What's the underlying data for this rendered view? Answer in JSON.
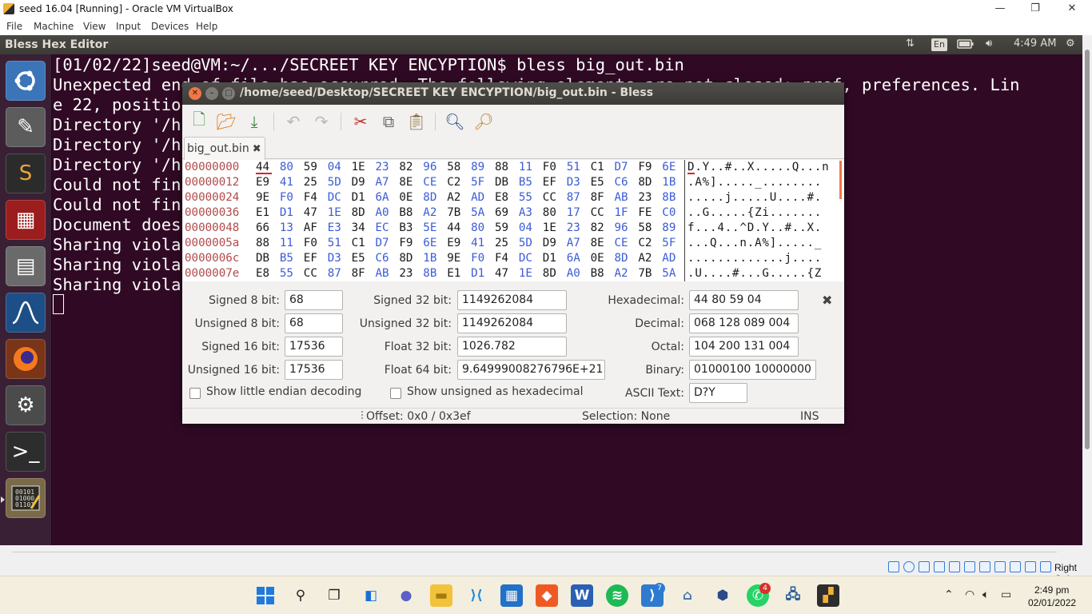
{
  "host_window": {
    "title": "seed 16.04 [Running] - Oracle VM VirtualBox",
    "menu": [
      "File",
      "Machine",
      "View",
      "Input",
      "Devices",
      "Help"
    ],
    "controls": {
      "minimize": "—",
      "restore": "❐",
      "close": "✕"
    }
  },
  "ubuntu_topbar": {
    "active_app": "Bless Hex Editor",
    "keyboard_layout": "En",
    "time": "4:49 AM",
    "icons": [
      "network-arrows-icon",
      "battery-icon",
      "volume-icon",
      "power-gear-icon"
    ]
  },
  "launcher": {
    "items": [
      "ubuntu-dash",
      "text-editor",
      "sublime-text",
      "remote-desktop",
      "file-manager",
      "wireshark",
      "firefox",
      "system-settings",
      "terminal",
      "bless-hex-editor"
    ]
  },
  "terminal": {
    "lines": [
      "[01/02/22]seed@VM:~/.../SECREET KEY ENCYPTION$ bless big_out.bin",
      "Unexpected end of file has occurred. The following elements are not closed: pref, preferences. Lin",
      "e 22, position",
      "Directory '/h",
      "Directory '/h",
      "Directory '/h",
      "Could not fin",
      "Could not fin",
      "Document does",
      "Sharing viola",
      "Sharing viola",
      "Sharing viola"
    ]
  },
  "bless": {
    "title": "/home/seed/Desktop/SECREET KEY ENCYPTION/big_out.bin - Bless",
    "tab_label": "big_out.bin",
    "hex_rows": [
      {
        "offset": "00000000",
        "bytes": [
          "44",
          "80",
          "59",
          "04",
          "1E",
          "23",
          "82",
          "96",
          "58",
          "89",
          "88",
          "11",
          "F0",
          "51",
          "C1",
          "D7",
          "F9",
          "6E"
        ],
        "ascii": "D.Y..#..X.....Q...n"
      },
      {
        "offset": "00000012",
        "bytes": [
          "E9",
          "41",
          "25",
          "5D",
          "D9",
          "A7",
          "8E",
          "CE",
          "C2",
          "5F",
          "DB",
          "B5",
          "EF",
          "D3",
          "E5",
          "C6",
          "8D",
          "1B"
        ],
        "ascii": ".A%]....._........"
      },
      {
        "offset": "00000024",
        "bytes": [
          "9E",
          "F0",
          "F4",
          "DC",
          "D1",
          "6A",
          "0E",
          "8D",
          "A2",
          "AD",
          "E8",
          "55",
          "CC",
          "87",
          "8F",
          "AB",
          "23",
          "8B"
        ],
        "ascii": ".....j.....U....#."
      },
      {
        "offset": "00000036",
        "bytes": [
          "E1",
          "D1",
          "47",
          "1E",
          "8D",
          "A0",
          "B8",
          "A2",
          "7B",
          "5A",
          "69",
          "A3",
          "80",
          "17",
          "CC",
          "1F",
          "FE",
          "C0"
        ],
        "ascii": "..G.....{Zi......."
      },
      {
        "offset": "00000048",
        "bytes": [
          "66",
          "13",
          "AF",
          "E3",
          "34",
          "EC",
          "B3",
          "5E",
          "44",
          "80",
          "59",
          "04",
          "1E",
          "23",
          "82",
          "96",
          "58",
          "89"
        ],
        "ascii": "f...4..^D.Y..#..X."
      },
      {
        "offset": "0000005a",
        "bytes": [
          "88",
          "11",
          "F0",
          "51",
          "C1",
          "D7",
          "F9",
          "6E",
          "E9",
          "41",
          "25",
          "5D",
          "D9",
          "A7",
          "8E",
          "CE",
          "C2",
          "5F"
        ],
        "ascii": "...Q...n.A%]....._"
      },
      {
        "offset": "0000006c",
        "bytes": [
          "DB",
          "B5",
          "EF",
          "D3",
          "E5",
          "C6",
          "8D",
          "1B",
          "9E",
          "F0",
          "F4",
          "DC",
          "D1",
          "6A",
          "0E",
          "8D",
          "A2",
          "AD"
        ],
        "ascii": ".............j...."
      },
      {
        "offset": "0000007e",
        "bytes": [
          "E8",
          "55",
          "CC",
          "87",
          "8F",
          "AB",
          "23",
          "8B",
          "E1",
          "D1",
          "47",
          "1E",
          "8D",
          "A0",
          "B8",
          "A2",
          "7B",
          "5A"
        ],
        "ascii": ".U....#...G.....{Z"
      }
    ],
    "conversion": {
      "signed_8_label": "Signed 8 bit:",
      "signed_8": "68",
      "unsigned_8_label": "Unsigned 8 bit:",
      "unsigned_8": "68",
      "signed_16_label": "Signed 16 bit:",
      "signed_16": "17536",
      "unsigned_16_label": "Unsigned 16 bit:",
      "unsigned_16": "17536",
      "signed_32_label": "Signed 32 bit:",
      "signed_32": "1149262084",
      "unsigned_32_label": "Unsigned 32 bit:",
      "unsigned_32": "1149262084",
      "float_32_label": "Float 32 bit:",
      "float_32": "1026.782",
      "float_64_label": "Float 64 bit:",
      "float_64": "9.64999008276796E+21",
      "hex_label": "Hexadecimal:",
      "hex": "44 80 59 04",
      "decimal_label": "Decimal:",
      "decimal": "068 128 089 004",
      "octal_label": "Octal:",
      "octal": "104 200 131 004",
      "binary_label": "Binary:",
      "binary": "01000100 10000000 01011001 00000100",
      "ascii_label": "ASCII Text:",
      "ascii": "D?Y",
      "little_endian_label": "Show little endian decoding",
      "unsigned_hex_label": "Show unsigned as hexadecimal"
    },
    "status": {
      "offset": "Offset: 0x0 / 0x3ef",
      "selection": "Selection: None",
      "mode": "INS"
    }
  },
  "vbox_status": {
    "host_key": "Right Ctrl"
  },
  "taskbar": {
    "time": "2:49 pm",
    "date": "02/01/2022",
    "badges": {
      "vscode_extra": "7",
      "whatsapp": "4"
    }
  }
}
